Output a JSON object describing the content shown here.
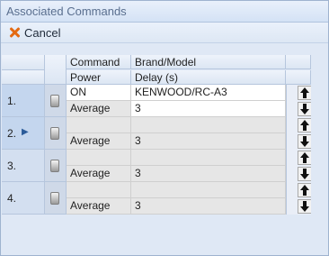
{
  "window": {
    "title": "Associated Commands"
  },
  "toolbar": {
    "cancel_label": "Cancel"
  },
  "columns": {
    "command": "Command",
    "brand_model": "Brand/Model",
    "power": "Power",
    "delay": "Delay (s)"
  },
  "rows": [
    {
      "number": "1.",
      "command": "ON",
      "brand_model": "KENWOOD/RC-A3",
      "power": "Average",
      "delay": "3"
    },
    {
      "number": "2.",
      "command": "",
      "brand_model": "",
      "power": "Average",
      "delay": "3"
    },
    {
      "number": "3.",
      "command": "",
      "brand_model": "",
      "power": "Average",
      "delay": "3"
    },
    {
      "number": "4.",
      "command": "",
      "brand_model": "",
      "power": "Average",
      "delay": "3"
    }
  ],
  "icons": {
    "cancel": "close-icon",
    "move_up": "arrow-up-icon",
    "move_down": "arrow-down-icon",
    "current_row": "row-pointer-icon",
    "toggle": "toggle-icon"
  },
  "colors": {
    "cancel_accent": "#e46a12",
    "header_bg": "#dfe8f5"
  }
}
